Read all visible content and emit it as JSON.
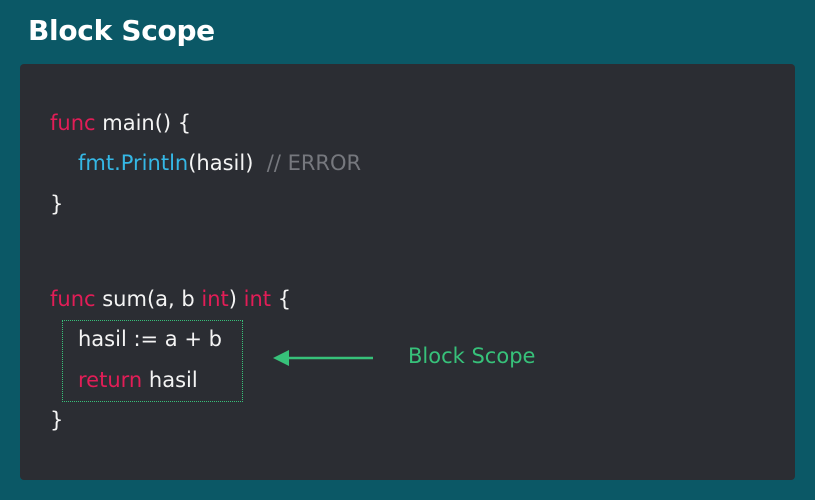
{
  "title": "Block Scope",
  "colors": {
    "background": "#0b5866",
    "panel": "#2b2d33",
    "keyword": "#e21d57",
    "function": "#35b8e6",
    "comment": "#76787e",
    "text": "#f4f4f4",
    "annotation": "#37c17a"
  },
  "code": {
    "line1": {
      "kw": "func",
      "rest": " main() {"
    },
    "line2": {
      "fn": "fmt.Println",
      "rest": "(hasil)  ",
      "comment": "// ERROR"
    },
    "line3": {
      "text": "}"
    },
    "line4": {
      "kw1": "func",
      "rest1": " sum(a, b ",
      "kw2": "int",
      "rest2": ") ",
      "kw3": "int",
      "rest3": " {"
    },
    "line5": {
      "text": "hasil := a + b"
    },
    "line6": {
      "kw": "return",
      "rest": " hasil"
    },
    "line7": {
      "text": "}"
    }
  },
  "annotation": {
    "label": "Block Scope"
  }
}
